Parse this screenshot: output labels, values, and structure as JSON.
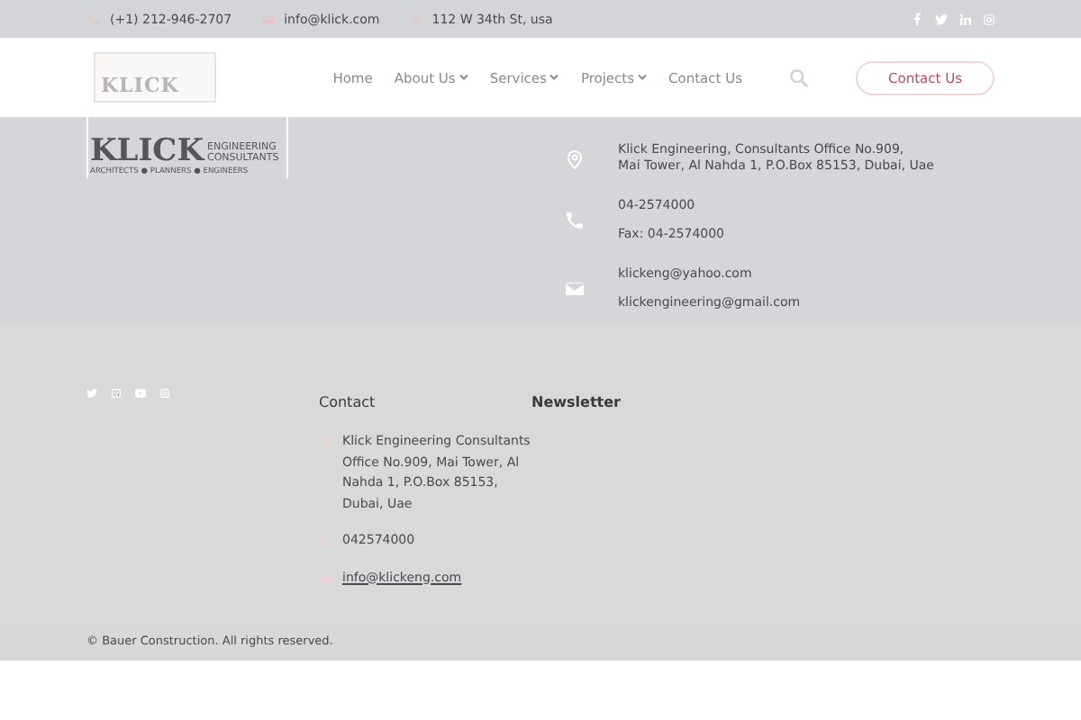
{
  "top_bar": {
    "contacts": [
      {
        "kind": "phone",
        "text": "(+1) 212-946-2707"
      },
      {
        "kind": "email",
        "text": "info@klick.com"
      },
      {
        "kind": "location",
        "text": "112 W 34th St, usa"
      }
    ]
  },
  "header": {
    "logo": {
      "name": "KLICK"
    },
    "nav": [
      {
        "label": "Home",
        "dropdown": false
      },
      {
        "label": "About Us",
        "dropdown": true
      },
      {
        "label": "Services",
        "dropdown": true
      },
      {
        "label": "Projects",
        "dropdown": true
      },
      {
        "label": "Contact Us",
        "dropdown": false
      }
    ],
    "button": "Contact Us"
  },
  "contact_band": {
    "logo": {
      "name": "KLICK",
      "line_1": "ENGINEERING",
      "line_2": "CONSULTANTS",
      "tagline": "ARCHITECTS ● PLANNERS ● ENGINEERS"
    },
    "items": [
      {
        "kind": "location",
        "lines": [
          "Klick Engineering, Consultants Office No.909,",
          "Mai Tower, Al Nahda 1, P.O.Box 85153, Dubai, Uae"
        ]
      },
      {
        "kind": "phone",
        "lines": [
          "04-2574000",
          "Fax: 04-2574000"
        ]
      },
      {
        "kind": "email",
        "lines": [
          "klickeng@yahoo.com",
          "klickengineering@gmail.com"
        ]
      }
    ]
  },
  "footer": {
    "contact": {
      "heading": "Contact",
      "items": [
        {
          "kind": "location",
          "text": "Klick Engineering Consultants Office No.909, Mai Tower, Al Nahda 1, P.O.Box 85153, Dubai, Uae",
          "link": false
        },
        {
          "kind": "phone",
          "text": "042574000",
          "link": false
        },
        {
          "kind": "email",
          "text": "info@klickeng.com",
          "link": true
        }
      ]
    },
    "newsletter": {
      "heading": "Newsletter"
    },
    "copyright": "© Bauer Construction. All rights reserved."
  }
}
